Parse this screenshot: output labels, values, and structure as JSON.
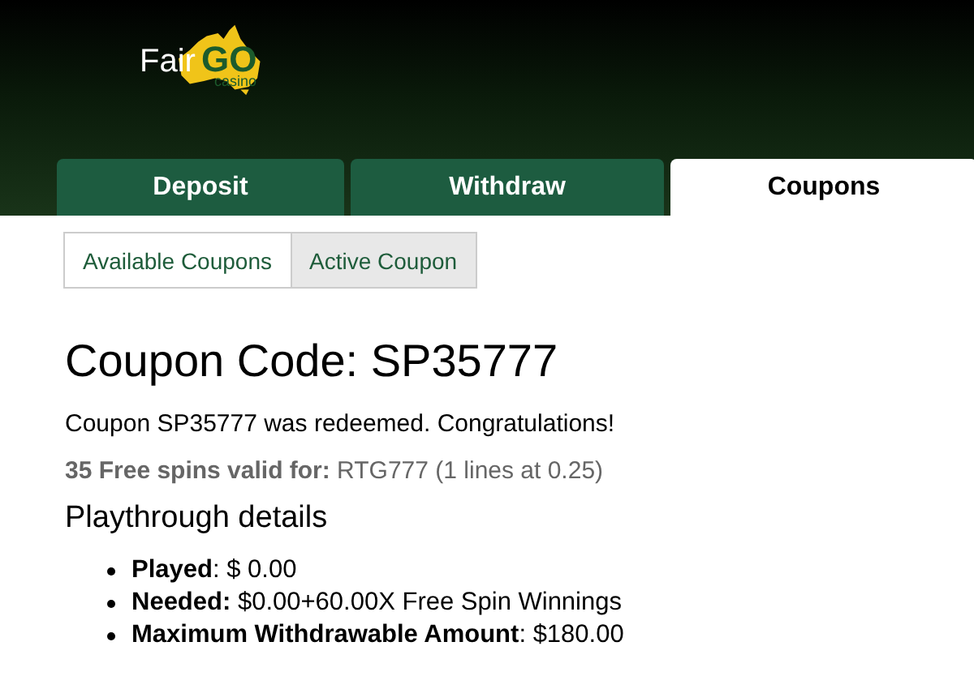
{
  "logo": {
    "word_1": "Fair",
    "word_2": "GO",
    "word_3": "casino"
  },
  "tabs": [
    {
      "label": "Deposit",
      "selected": false
    },
    {
      "label": "Withdraw",
      "selected": false
    },
    {
      "label": "Coupons",
      "selected": true
    }
  ],
  "subtabs": [
    {
      "label": "Available Coupons",
      "selected": false
    },
    {
      "label": "Active Coupon",
      "selected": true
    }
  ],
  "heading": "Coupon Code: SP35777",
  "message": "Coupon SP35777 was redeemed. Congratulations!",
  "free_spins": "**35 Free spins valid for:** RTG777 (1 lines at 0.25)",
  "playthrough_title": "Playthrough details",
  "details": [
    "**Played**: $ 0.00",
    "**Needed:** $0.00+60.00X Free Spin Winnings",
    "**Maximum Withdrawable Amount**: $180.00"
  ]
}
